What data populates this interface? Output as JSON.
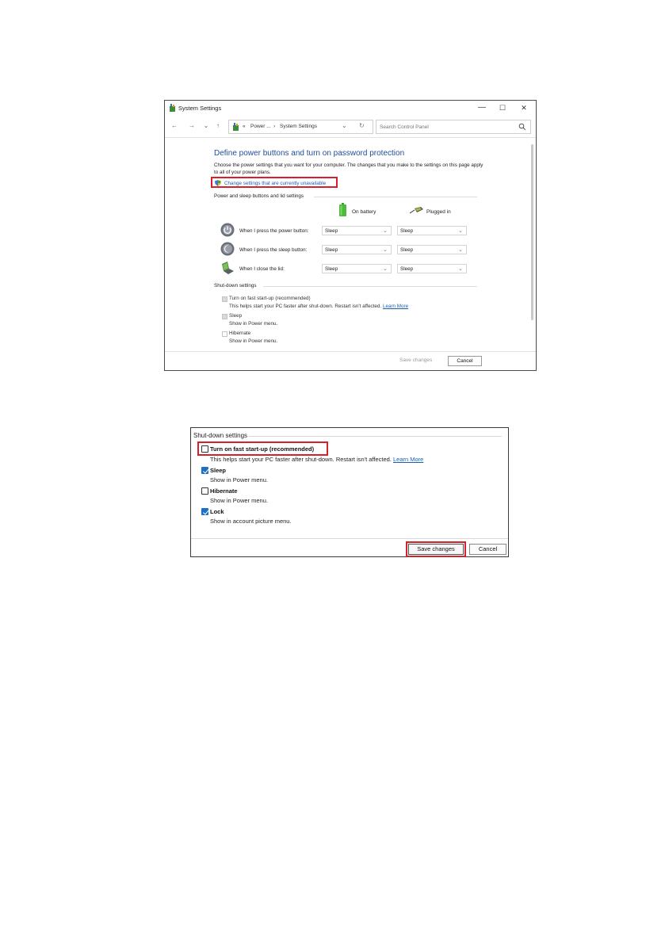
{
  "window": {
    "title": "System Settings",
    "controls": {
      "minimize": "—",
      "maximize": "☐",
      "close": "✕"
    },
    "nav": {
      "back": "←",
      "forward": "→",
      "recent": "⌄",
      "up": "↑"
    },
    "address": {
      "prefix": "«",
      "crumb1": "Power ...",
      "sep": "›",
      "crumb2": "System Settings",
      "dropdown": "⌄",
      "refresh": "↻"
    },
    "search": {
      "placeholder": "Search Control Panel"
    },
    "heading": "Define power buttons and turn on password protection",
    "intro": "Choose the power settings that you want for your computer. The changes that you make to the settings on this page apply to all of your power plans.",
    "change_link": "Change settings that are currently unavailable",
    "power_section": "Power and sleep buttons and lid settings",
    "columns": {
      "battery": "On battery",
      "plugged": "Plugged in"
    },
    "rows": [
      {
        "label": "When I press the power button:",
        "battery": "Sleep",
        "plugged": "Sleep",
        "icon": "power-button-icon"
      },
      {
        "label": "When I press the sleep button:",
        "battery": "Sleep",
        "plugged": "Sleep",
        "icon": "sleep-button-icon"
      },
      {
        "label": "When I close the lid:",
        "battery": "Sleep",
        "plugged": "Sleep",
        "icon": "laptop-lid-icon"
      }
    ],
    "shutdown_section": "Shut-down settings",
    "options": [
      {
        "title": "Turn on fast start-up (recommended)",
        "desc": "This helps start your PC faster after shut-down. Restart isn't affected.",
        "link": "Learn More",
        "checked": true
      },
      {
        "title": "Sleep",
        "desc": "Show in Power menu.",
        "checked": true
      },
      {
        "title": "Hibernate",
        "desc": "Show in Power menu.",
        "checked": false
      }
    ],
    "save": "Save changes",
    "cancel": "Cancel"
  },
  "panel2": {
    "heading": "Shut-down settings",
    "options": [
      {
        "title": "Turn on fast start-up (recommended)",
        "desc": "This helps start your PC faster after shut-down. Restart isn't affected.",
        "link": "Learn More",
        "checked": false
      },
      {
        "title": "Sleep",
        "desc": "Show in Power menu.",
        "checked": true
      },
      {
        "title": "Hibernate",
        "desc": "Show in Power menu.",
        "checked": false
      },
      {
        "title": "Lock",
        "desc": "Show in account picture menu.",
        "checked": true
      }
    ],
    "save": "Save changes",
    "cancel": "Cancel"
  },
  "colors": {
    "heading_blue": "#1f4e99",
    "link_blue": "#1a5fb4",
    "highlight_red": "#d6202a",
    "checkbox_blue": "#1f6fc5"
  }
}
